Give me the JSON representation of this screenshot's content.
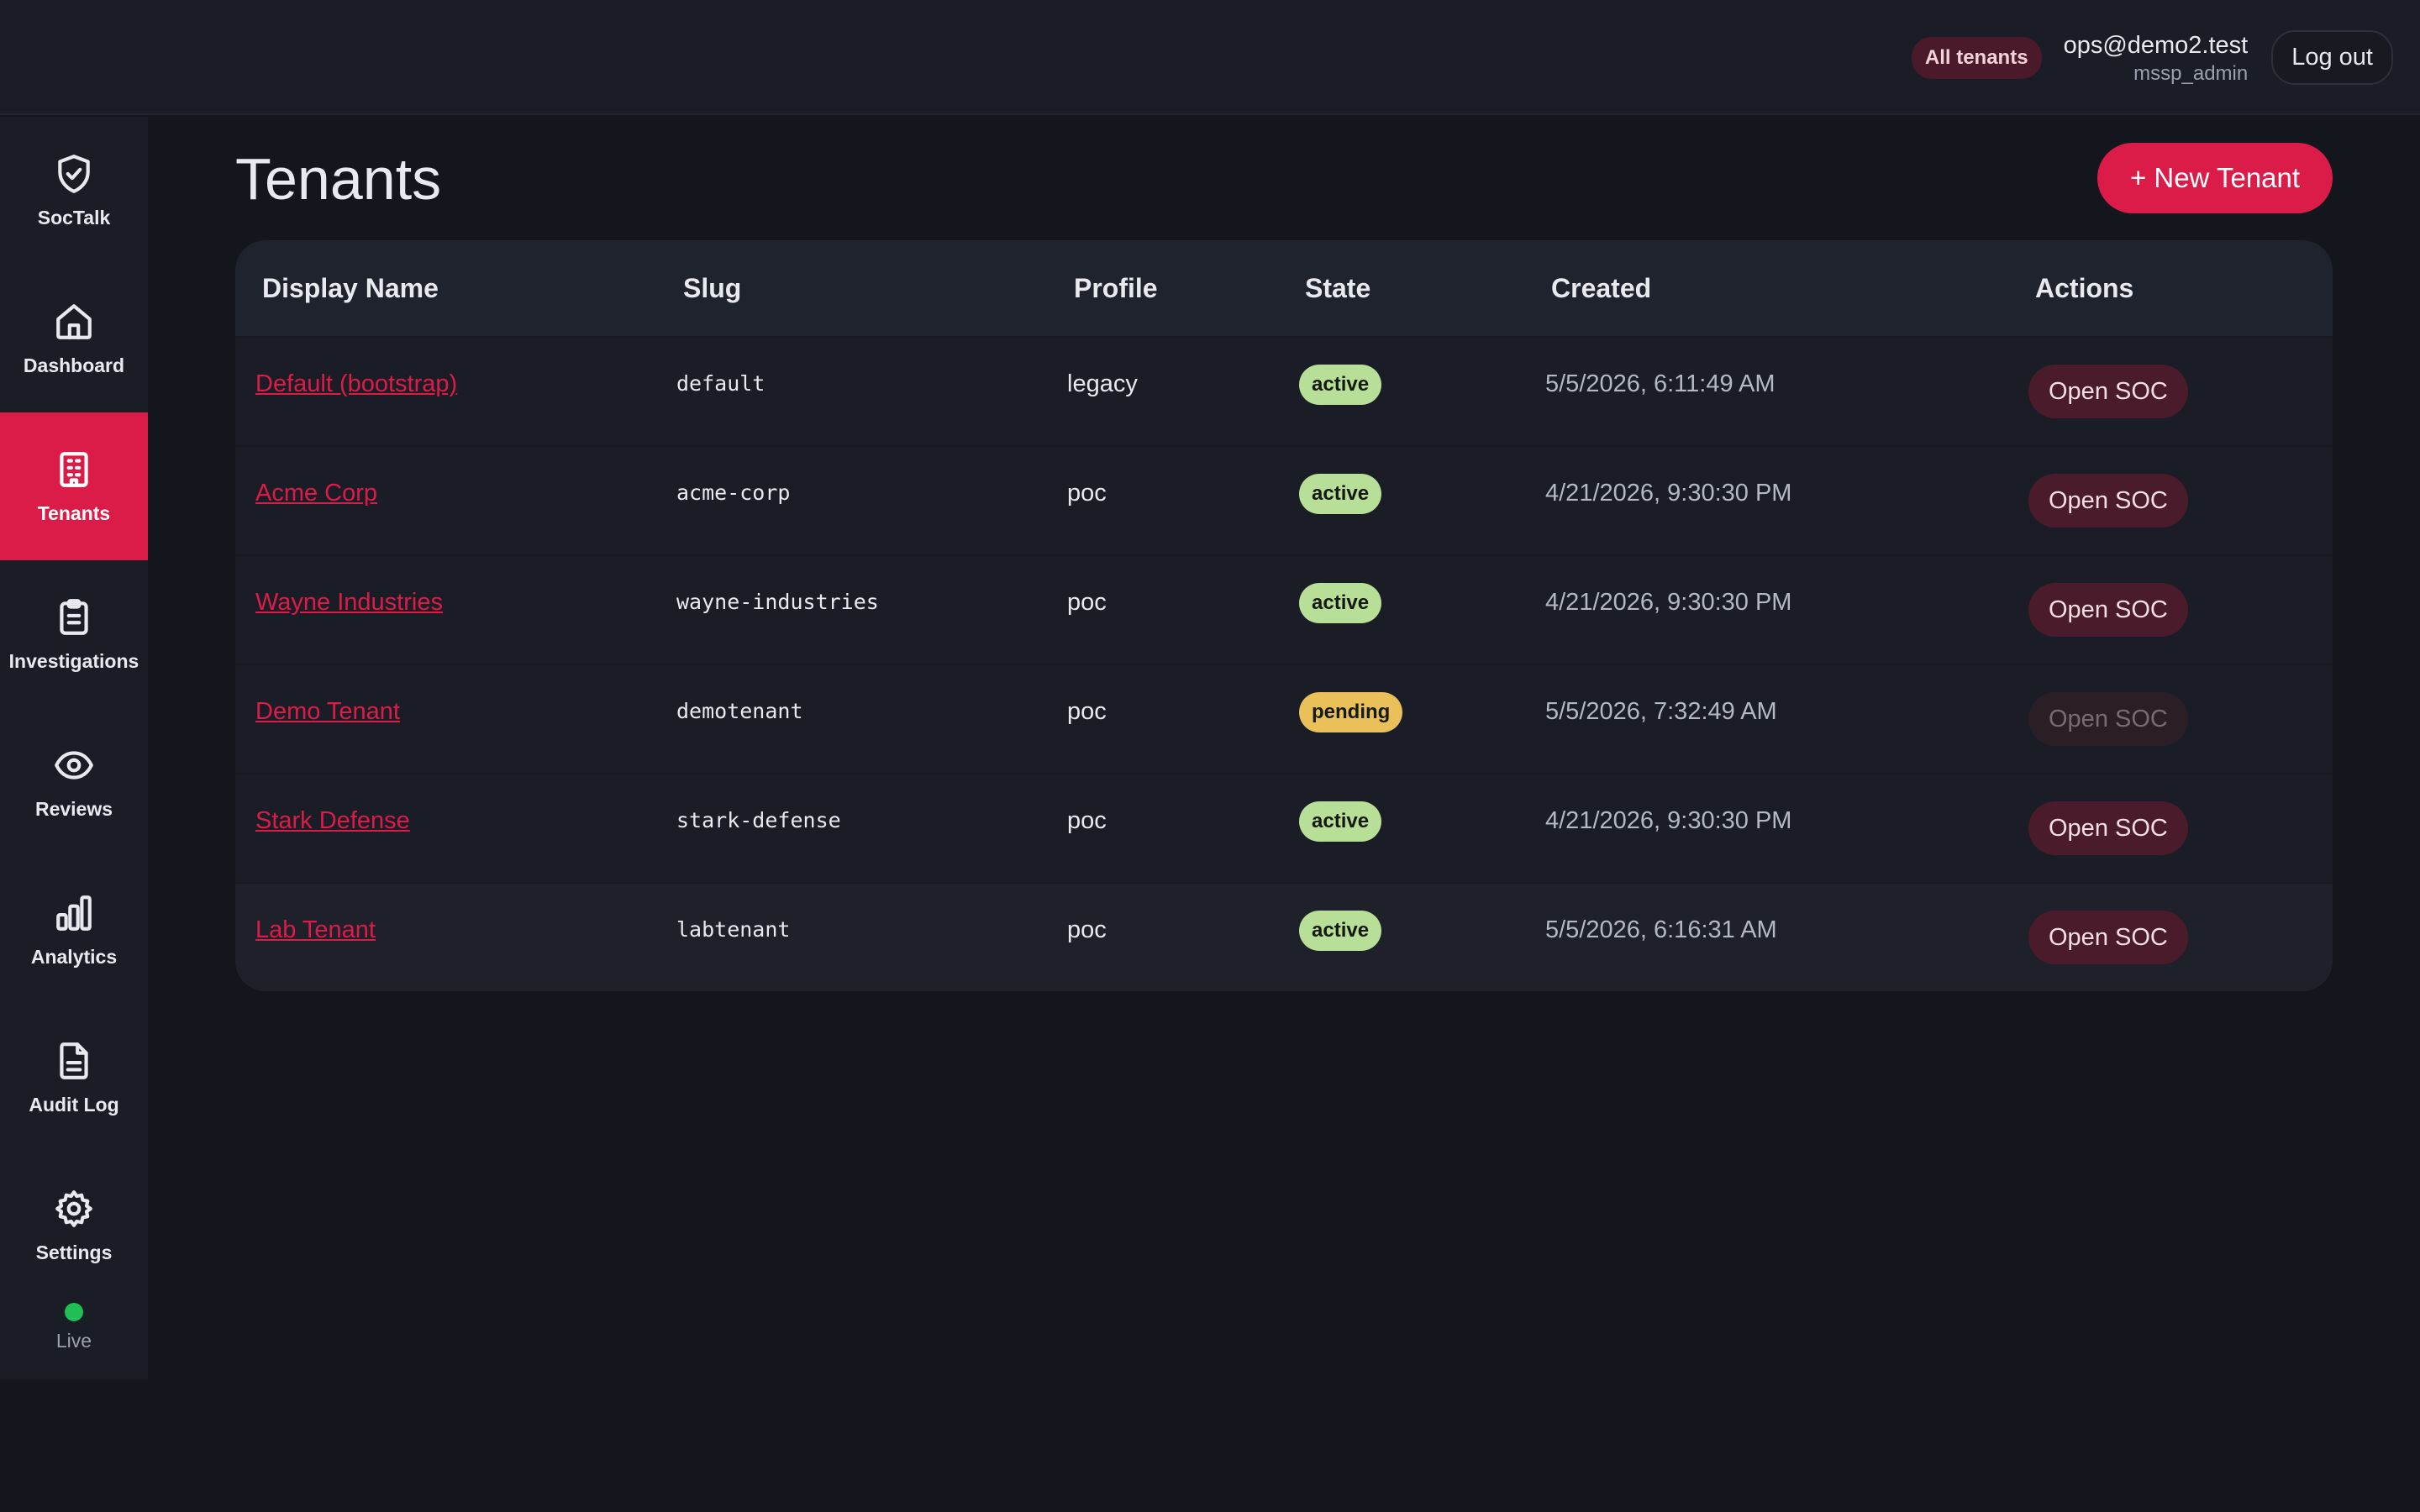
{
  "header": {
    "scope_badge": "All tenants",
    "user_email": "ops@demo2.test",
    "user_role": "mssp_admin",
    "logout_label": "Log out"
  },
  "sidebar": {
    "items": [
      {
        "label": "SocTalk",
        "icon": "shield-check-icon"
      },
      {
        "label": "Dashboard",
        "icon": "home-icon"
      },
      {
        "label": "Tenants",
        "icon": "building-icon",
        "active": true
      },
      {
        "label": "Investigations",
        "icon": "clipboard-icon"
      },
      {
        "label": "Reviews",
        "icon": "eye-icon"
      },
      {
        "label": "Analytics",
        "icon": "bar-chart-icon"
      },
      {
        "label": "Audit Log",
        "icon": "file-text-icon"
      },
      {
        "label": "Settings",
        "icon": "gear-icon"
      }
    ],
    "status_label": "Live",
    "status_color": "#1fbf55"
  },
  "main": {
    "title": "Tenants",
    "new_button_label": "+ New Tenant",
    "columns": [
      "Display Name",
      "Slug",
      "Profile",
      "State",
      "Created",
      "Actions"
    ],
    "rows": [
      {
        "name": "Default (bootstrap)",
        "slug": "default",
        "profile": "legacy",
        "state": "active",
        "created": "5/5/2026, 6:11:49 AM",
        "action": "Open SOC"
      },
      {
        "name": "Acme Corp",
        "slug": "acme-corp",
        "profile": "poc",
        "state": "active",
        "created": "4/21/2026, 9:30:30 PM",
        "action": "Open SOC"
      },
      {
        "name": "Wayne Industries",
        "slug": "wayne-industries",
        "profile": "poc",
        "state": "active",
        "created": "4/21/2026, 9:30:30 PM",
        "action": "Open SOC"
      },
      {
        "name": "Demo Tenant",
        "slug": "demotenant",
        "profile": "poc",
        "state": "pending",
        "created": "5/5/2026, 7:32:49 AM",
        "action": "Open SOC"
      },
      {
        "name": "Stark Defense",
        "slug": "stark-defense",
        "profile": "poc",
        "state": "active",
        "created": "4/21/2026, 9:30:30 PM",
        "action": "Open SOC"
      },
      {
        "name": "Lab Tenant",
        "slug": "labtenant",
        "profile": "poc",
        "state": "active",
        "created": "5/5/2026, 6:16:31 AM",
        "action": "Open SOC"
      }
    ]
  },
  "colors": {
    "accent": "#dc1c48",
    "active_badge": "#b8df98",
    "pending_badge": "#e9c05a"
  }
}
